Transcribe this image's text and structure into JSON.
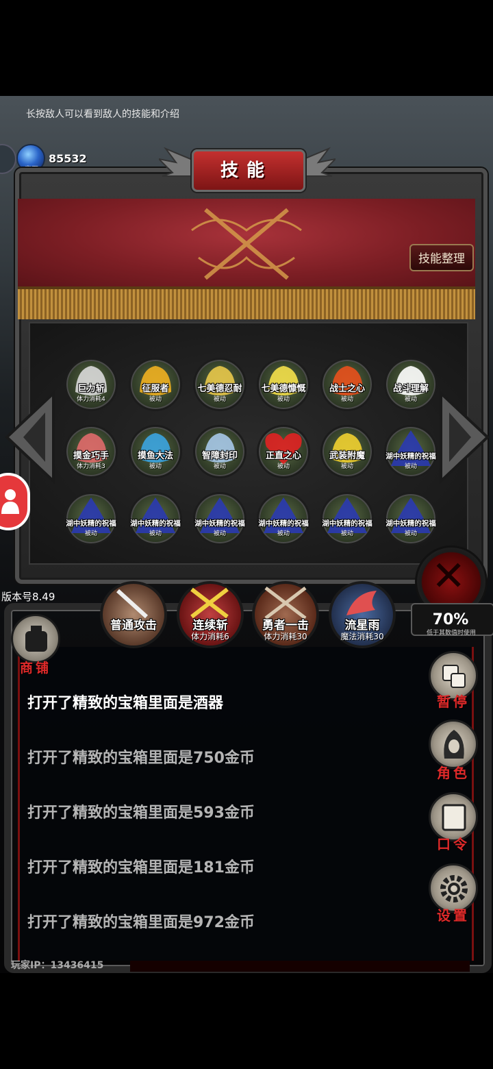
{
  "hint": "长按敌人可以看到敌人的技能和介绍",
  "currency": {
    "label": "宝石",
    "count": "85532"
  },
  "panel": {
    "title": "技能",
    "organize_button": "技能整理"
  },
  "skills": [
    {
      "name": "巨力斩",
      "sub": "体力消耗4",
      "color": "#d9d9d9",
      "icon": "claw-slash-icon"
    },
    {
      "name": "征服者",
      "sub": "被动",
      "color": "#f0b020",
      "icon": "wolf-head-icon"
    },
    {
      "name": "七美德忍耐",
      "sub": "被动",
      "color": "#e8c84a",
      "icon": "swirl-icon"
    },
    {
      "name": "七美德慷慨",
      "sub": "被动",
      "color": "#f4e04a",
      "icon": "crown-icon"
    },
    {
      "name": "战士之心",
      "sub": "被动",
      "color": "#e8501c",
      "icon": "helmet-icon"
    },
    {
      "name": "战斗理解",
      "sub": "被动",
      "color": "#ffffff",
      "icon": "crossed-swords-icon"
    },
    {
      "name": "摸金巧手",
      "sub": "体力消耗3",
      "color": "#e06a6a",
      "icon": "hand-icon"
    },
    {
      "name": "摸鱼大法",
      "sub": "被动",
      "color": "#3ba4e0",
      "icon": "fish-icon"
    },
    {
      "name": "智障封印",
      "sub": "被动",
      "color": "#a6c8e8",
      "icon": "hooded-figure-icon"
    },
    {
      "name": "正直之心",
      "sub": "被动",
      "color": "#e02222",
      "icon": "heart-icon"
    },
    {
      "name": "武装附魔",
      "sub": "被动",
      "color": "#f0d030",
      "icon": "wings-icon"
    },
    {
      "name": "湖中妖精的祝福",
      "sub": "被动",
      "color": "#2a3ab0",
      "icon": "drop-icon"
    },
    {
      "name": "湖中妖精的祝福",
      "sub": "被动",
      "color": "#2a3ab0",
      "icon": "drop-icon"
    },
    {
      "name": "湖中妖精的祝福",
      "sub": "被动",
      "color": "#2a3ab0",
      "icon": "drop-icon"
    },
    {
      "name": "湖中妖精的祝福",
      "sub": "被动",
      "color": "#2a3ab0",
      "icon": "drop-icon"
    },
    {
      "name": "湖中妖精的祝福",
      "sub": "被动",
      "color": "#2a3ab0",
      "icon": "drop-icon"
    },
    {
      "name": "湖中妖精的祝福",
      "sub": "被动",
      "color": "#2a3ab0",
      "icon": "drop-icon"
    },
    {
      "name": "湖中妖精的祝福",
      "sub": "被动",
      "color": "#2a3ab0",
      "icon": "drop-icon"
    }
  ],
  "version": "版本号8.49",
  "counter": {
    "value": "70%",
    "note": "低于其数值时使用"
  },
  "actions": [
    {
      "name": "普通攻击",
      "sub": "",
      "color": "#7a5a4a"
    },
    {
      "name": "连续斩",
      "sub": "体力消耗6",
      "color": "#8a2222"
    },
    {
      "name": "勇者一击",
      "sub": "体力消耗30",
      "color": "#6a2222"
    },
    {
      "name": "流星雨",
      "sub": "魔法消耗30",
      "color": "#2a3a6a"
    }
  ],
  "shop_label": "商铺",
  "side_menu": [
    {
      "label": "暂停",
      "icon": "dice-icon"
    },
    {
      "label": "角色",
      "icon": "hooded-face-icon"
    },
    {
      "label": "口令",
      "icon": "book-icon"
    },
    {
      "label": "设置",
      "icon": "gear-icon"
    }
  ],
  "log": [
    "打开了精致的宝箱里面是酒器",
    "打开了精致的宝箱里面是750金币",
    "打开了精致的宝箱里面是593金币",
    "打开了精致的宝箱里面是181金币",
    "打开了精致的宝箱里面是972金币"
  ],
  "player_ip": "玩家IP：13436415"
}
